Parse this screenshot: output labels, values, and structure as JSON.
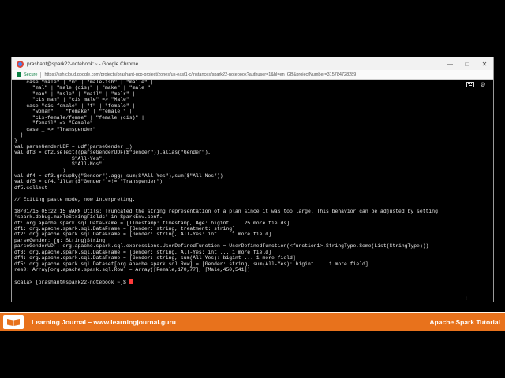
{
  "browser": {
    "title": "prashant@spark22-notebook:~ - Google Chrome",
    "secure_label": "Secure",
    "url": "https://ssh.cloud.google.com/projects/prashant-gcp-project/zones/us-east1-c/instances/spark22-notebook?authuser=1&hl=en_GB&projectNumber=315784728289",
    "controls": {
      "minimize": "—",
      "maximize": "□",
      "close": "✕"
    }
  },
  "terminal": {
    "lines": [
      "    case \"male\" | \"m\" | \"male-ish\" | \"maile\" |",
      "      \"mal\" | \"male (cis)\" | \"make\" | \"male \" |",
      "      \"man\" | \"msle\" | \"mail\" | \"malr\" |",
      "      \"cis man\" | \"cis male\" => \"Male\"",
      "    case \"cis female\" | \"f\" | \"female\" |",
      "      \"woman\" |  \"femake\" | \"female \" |",
      "      \"cis-female/femme\" | \"female (cis)\" |",
      "      \"femail\" => \"Female\"",
      "    case _ => \"Transgender\"",
      "  }",
      "}",
      "val parseGenderUDF = udf(parseGender _)",
      "val df3 = df2.select((parseGenderUDF($\"Gender\")).alias(\"Gender\"),",
      "                   $\"All-Yes\",",
      "                   $\"All-Nos\"",
      "                )",
      "val df4 = df3.groupBy(\"Gender\").agg( sum($\"All-Yes\"),sum($\"All-Nos\"))",
      "val df5 = df4.filter($\"Gender\" =!= \"Transgender\")",
      "df5.collect",
      "",
      "// Exiting paste mode, now interpreting.",
      "",
      "18/01/15 05:22:15 WARN Utils: Truncated the string representation of a plan since it was too large. This behavior can be adjusted by setting",
      "'spark.debug.maxToStringFields' in SparkEnv.conf.",
      "df: org.apache.spark.sql.DataFrame = [Timestamp: timestamp, Age: bigint ... 25 more fields]",
      "df1: org.apache.spark.sql.DataFrame = [Gender: string, treatment: string]",
      "df2: org.apache.spark.sql.DataFrame = [Gender: string, All-Yes: int ... 1 more field]",
      "parseGender: (g: String)String",
      "parseGenderUDF: org.apache.spark.sql.expressions.UserDefinedFunction = UserDefinedFunction(<function1>,StringType,Some(List(StringType)))",
      "df3: org.apache.spark.sql.DataFrame = [Gender: string, All-Yes: int ... 1 more field]",
      "df4: org.apache.spark.sql.DataFrame = [Gender: string, sum(All-Yes): bigint ... 1 more field]",
      "df5: org.apache.spark.sql.Dataset[org.apache.spark.sql.Row] = [Gender: string, sum(All-Yes): bigint ... 1 more field]",
      "res0: Array[org.apache.spark.sql.Row] = Array([Female,170,77], [Male,450,541])",
      "",
      "scala> [prashant@spark22-notebook ~]$ "
    ]
  },
  "footer": {
    "left_text": "Learning Journal – www.learningjournal.guru",
    "right_text": "Apache Spark Tutorial"
  },
  "colors": {
    "accent": "#e8721c",
    "cursor": "#ff3b3b",
    "terminal_bg": "#000000",
    "terminal_fg": "#e6e6e6"
  }
}
